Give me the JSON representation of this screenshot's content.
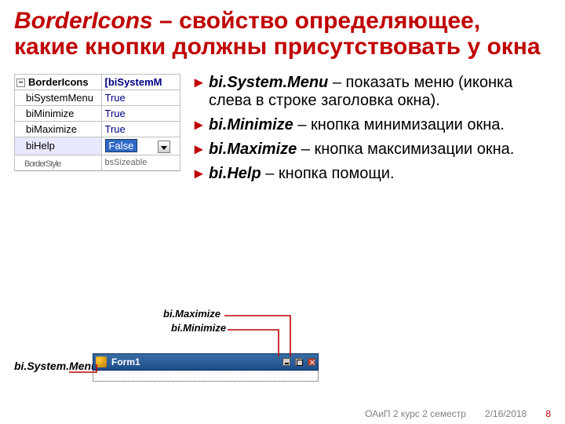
{
  "title": {
    "term": "BorderIcons",
    "rest": " – свойство определяющее, какие кнопки должны присутствовать у окна"
  },
  "inspector": {
    "root": "BorderIcons",
    "root_value": "[biSystemM",
    "rows": [
      {
        "name": "biSystemMenu",
        "value": "True"
      },
      {
        "name": "biMinimize",
        "value": "True"
      },
      {
        "name": "biMaximize",
        "value": "True"
      },
      {
        "name": "biHelp",
        "value": "False",
        "highlight": true
      }
    ],
    "cutoff_name": "BorderStyle",
    "cutoff_value": "bsSizeable"
  },
  "bullets": [
    {
      "term": "bi.System.Menu",
      "desc": " – показать меню (иконка слева в строке заголовка окна)."
    },
    {
      "term": "bi.Minimize",
      "desc": " – кнопка минимизации окна."
    },
    {
      "term": "bi.Maximize",
      "desc": " – кнопка максимизации окна."
    },
    {
      "term": "bi.Help",
      "desc": " – кнопка помощи."
    }
  ],
  "labels": {
    "sysmenu": "bi.System.Menu",
    "max": "bi.Maximize",
    "min": "bi.Minimize"
  },
  "form_title": "Form1",
  "footer": {
    "course": "ОАиП 2 курс 2 семестр",
    "date": "2/16/2018",
    "page": "8"
  },
  "colors": {
    "accent": "#c00000",
    "value": "#000080",
    "select": "#316ac5"
  }
}
